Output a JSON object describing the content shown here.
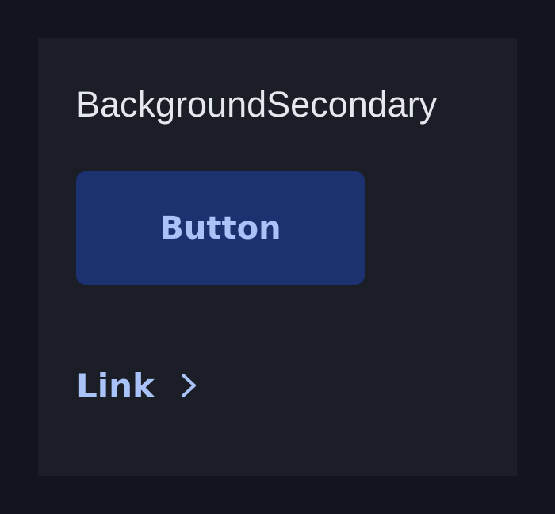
{
  "panel": {
    "title": "BackgroundSecondary",
    "button_label": "Button",
    "link_label": "Link",
    "link_icon": "chevron-right-icon"
  },
  "colors": {
    "page_background": "#12151d",
    "panel_background": "#1b1e27",
    "title_text": "#e6e8ef",
    "button_background": "#1b3170",
    "accent_text": "#a9c2f7"
  }
}
